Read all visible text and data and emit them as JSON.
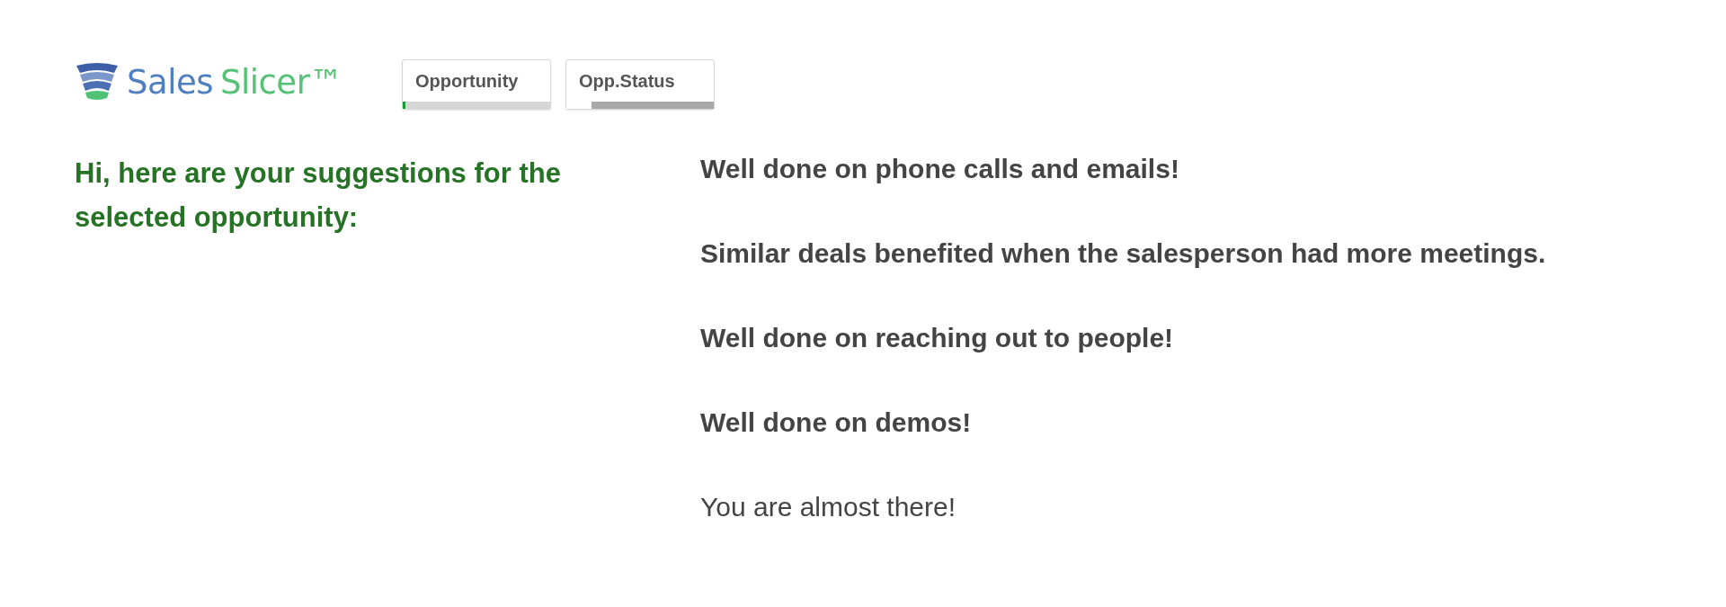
{
  "logo": {
    "parts": [
      {
        "text": "Sales",
        "color": "#4f7fc0"
      },
      {
        "text": "Slicer™",
        "color": "#55c277"
      }
    ]
  },
  "filters": [
    {
      "label": "Opportunity",
      "kind": "selected",
      "level": 0.02
    },
    {
      "label": "Opp.Status",
      "kind": "excluded",
      "level": 0.17
    }
  ],
  "greeting": "Hi, here are your suggestions for the selected opportunity:",
  "suggestions": [
    {
      "text": "Well done on phone calls and emails!",
      "kind": "bold"
    },
    {
      "text": "Similar deals benefited when the salesperson had more meetings.",
      "kind": "bold"
    },
    {
      "text": "Well done on reaching out to people!",
      "kind": "bold"
    },
    {
      "text": "Well done on demos!",
      "kind": "bold"
    },
    {
      "text": "You are almost there!",
      "kind": "plain"
    }
  ]
}
